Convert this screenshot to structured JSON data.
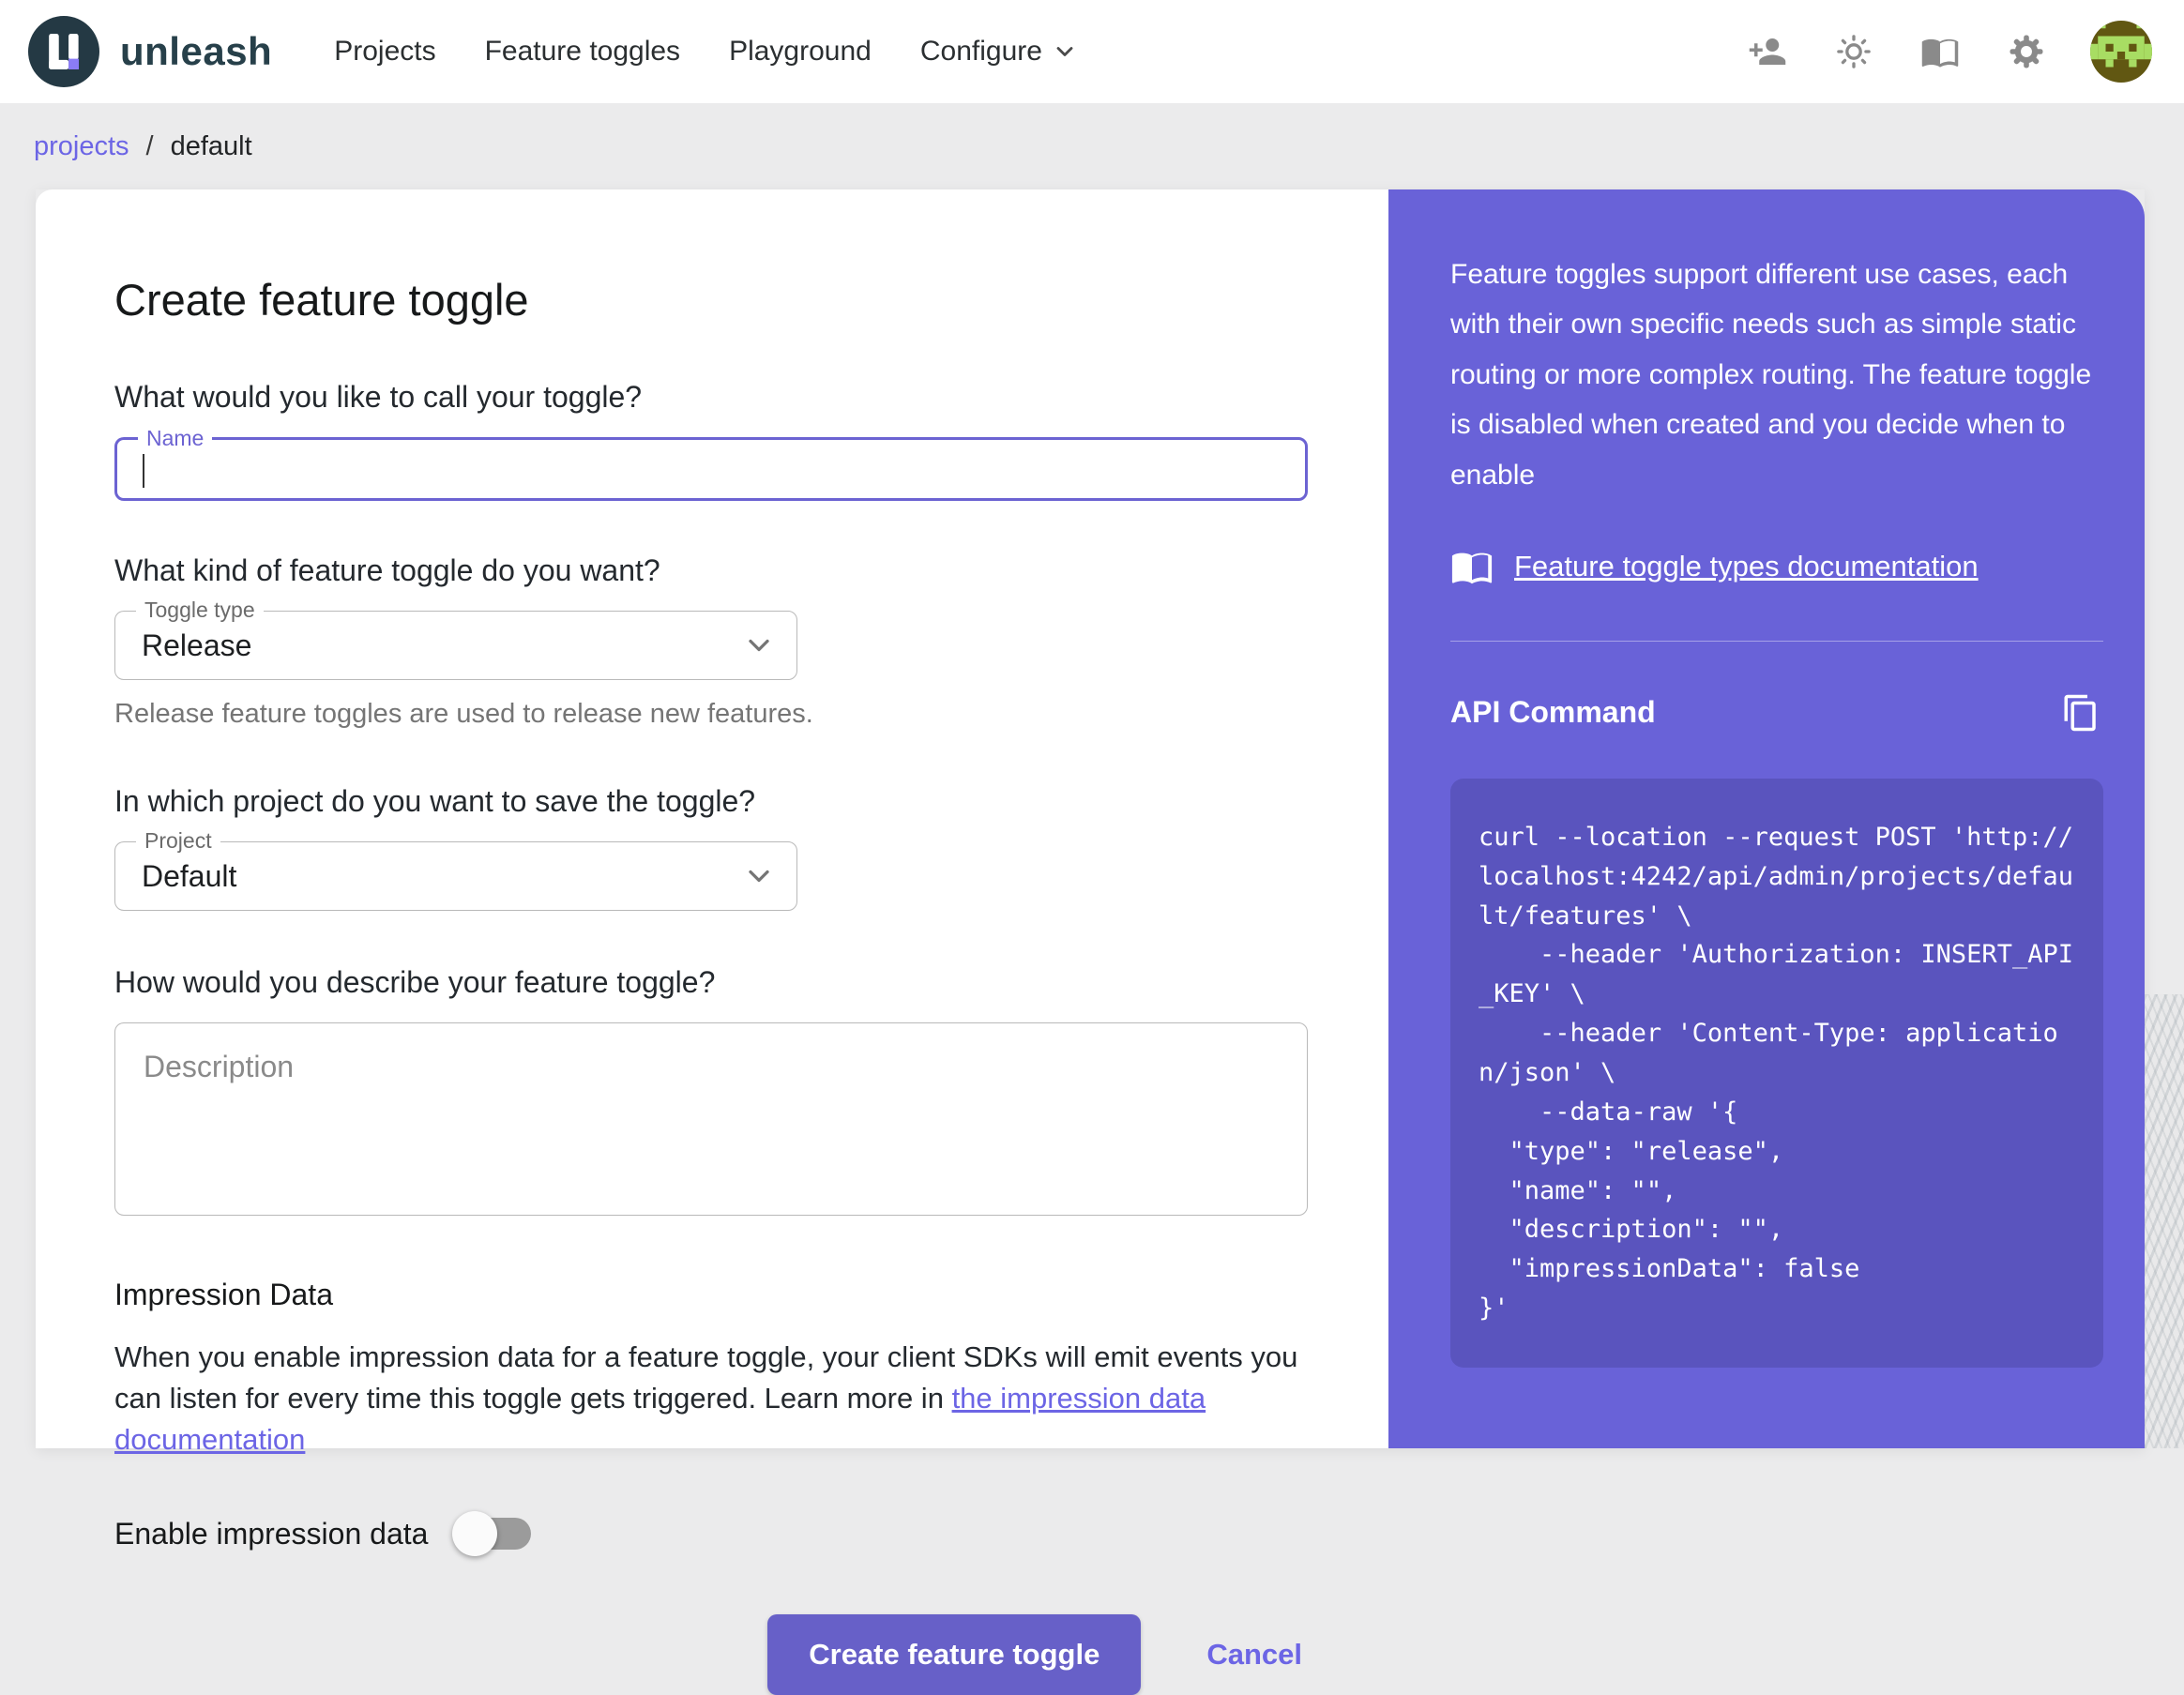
{
  "header": {
    "brand": "unleash",
    "nav": [
      {
        "label": "Projects"
      },
      {
        "label": "Feature toggles"
      },
      {
        "label": "Playground"
      },
      {
        "label": "Configure"
      }
    ],
    "action_icons": [
      {
        "name": "invite-user-icon"
      },
      {
        "name": "theme-brightness-icon"
      },
      {
        "name": "documentation-icon"
      },
      {
        "name": "settings-icon"
      },
      {
        "name": "user-avatar"
      }
    ]
  },
  "breadcrumb": {
    "link": "projects",
    "separator": "/",
    "current": "default"
  },
  "form": {
    "title": "Create feature toggle",
    "name_question": "What would you like to call your toggle?",
    "name_label": "Name",
    "name_value": "",
    "type_question": "What kind of feature toggle do you want?",
    "type_label": "Toggle type",
    "type_value": "Release",
    "type_helper": "Release feature toggles are used to release new features.",
    "project_question": "In which project do you want to save the toggle?",
    "project_label": "Project",
    "project_value": "Default",
    "description_question": "How would you describe your feature toggle?",
    "description_placeholder": "Description",
    "impression_heading": "Impression Data",
    "impression_text": "When you enable impression data for a feature toggle, your client SDKs will emit events you can listen for every time this toggle gets triggered. Learn more in ",
    "impression_link": "the impression data documentation",
    "enable_label": "Enable impression data",
    "enable_state": "off",
    "submit_label": "Create feature toggle",
    "cancel_label": "Cancel"
  },
  "sidebar": {
    "intro": "Feature toggles support different use cases, each with their own specific needs such as simple static routing or more complex routing. The feature toggle is disabled when created and you decide when to enable",
    "docs_link": "Feature toggle types documentation",
    "api_heading": "API Command",
    "api_command": "curl --location --request POST 'http://localhost:4242/api/admin/projects/default/features' \\\n    --header 'Authorization: INSERT_API_KEY' \\\n    --header 'Content-Type: application/json' \\\n    --data-raw '{\n  \"type\": \"release\",\n  \"name\": \"\",\n  \"description\": \"\",\n  \"impressionData\": false\n}'"
  },
  "colors": {
    "primary": "#6C63D2",
    "sidebar_bg": "#6962D8",
    "code_bg": "#5A54BE",
    "link": "#6C65E5",
    "logo_bg": "#243944",
    "page_bg": "#EBEBEC"
  }
}
